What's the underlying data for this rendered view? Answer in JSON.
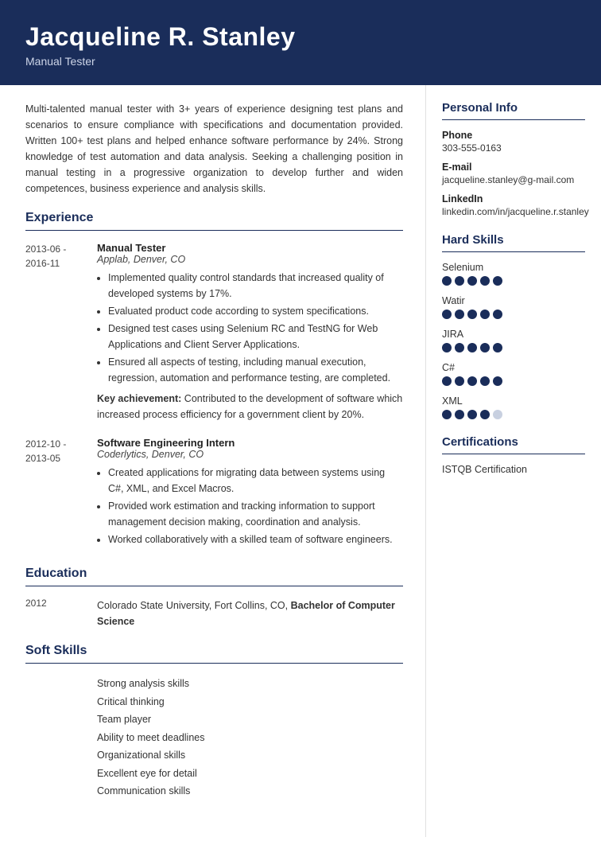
{
  "header": {
    "name": "Jacqueline R. Stanley",
    "title": "Manual Tester"
  },
  "summary": "Multi-talented manual tester with 3+ years of experience designing test plans and scenarios to ensure compliance with specifications and documentation provided. Written 100+ test plans and helped enhance software performance by 24%. Strong knowledge of test automation and data analysis. Seeking a challenging position in manual testing in a progressive organization to develop further and widen competences, business experience and analysis skills.",
  "sections": {
    "experience_label": "Experience",
    "education_label": "Education",
    "soft_skills_label": "Soft Skills"
  },
  "experience": [
    {
      "dates": "2013-06 -\n2016-11",
      "title": "Manual Tester",
      "company": "Applab, Denver, CO",
      "bullets": [
        "Implemented quality control standards that increased quality of developed systems by 17%.",
        "Evaluated product code according to system specifications.",
        "Designed test cases using Selenium RC and TestNG for Web Applications and Client Server Applications.",
        "Ensured all aspects of testing, including manual execution, regression, automation and performance testing, are completed."
      ],
      "key_achievement": "Key achievement: Contributed to the development of software which increased process efficiency for a government client by 20%."
    },
    {
      "dates": "2012-10 -\n2013-05",
      "title": "Software Engineering Intern",
      "company": "Coderlytics, Denver, CO",
      "bullets": [
        "Created applications for migrating data between systems using C#, XML, and Excel Macros.",
        "Provided work estimation and tracking information to support management decision making, coordination and analysis.",
        "Worked collaboratively with a skilled team of software engineers."
      ],
      "key_achievement": ""
    }
  ],
  "education": [
    {
      "year": "2012",
      "detail": "Colorado State University, Fort Collins, CO, ",
      "degree": "Bachelor of Computer Science"
    }
  ],
  "soft_skills": [
    "Strong analysis skills",
    "Critical thinking",
    "Team player",
    "Ability to meet deadlines",
    "Organizational skills",
    "Excellent eye for detail",
    "Communication skills"
  ],
  "sidebar": {
    "personal_info_label": "Personal Info",
    "phone_label": "Phone",
    "phone_value": "303-555-0163",
    "email_label": "E-mail",
    "email_value": "jacqueline.stanley@g-mail.com",
    "linkedin_label": "LinkedIn",
    "linkedin_value": "linkedin.com/in/jacqueline.r.stanley",
    "hard_skills_label": "Hard Skills",
    "hard_skills": [
      {
        "name": "Selenium",
        "filled": 5,
        "total": 5
      },
      {
        "name": "Watir",
        "filled": 5,
        "total": 5
      },
      {
        "name": "JIRA",
        "filled": 5,
        "total": 5
      },
      {
        "name": "C#",
        "filled": 5,
        "total": 5
      },
      {
        "name": "XML",
        "filled": 4,
        "total": 5
      }
    ],
    "certifications_label": "Certifications",
    "certifications": [
      "ISTQB Certification"
    ]
  }
}
